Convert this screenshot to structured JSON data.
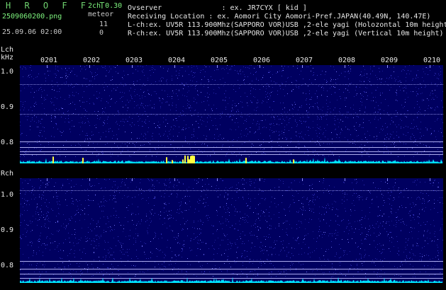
{
  "app_title": "H R O F F T",
  "file_name": "2509060200.png",
  "date_time": "25.09.06 02:00",
  "version": "2ch 0.30",
  "meteor_label": "meteor",
  "meteor_counts": {
    "lch": "11",
    "rch": "0"
  },
  "header": {
    "observer": "Ovserver              : ex. JR7CYX [ kid ]",
    "location": "Receiving Location : ex. Aomori City Aomori-Pref.JAPAN(40.49N, 140.47E)",
    "lch_info": "L-ch:ex. UV5R 113.900Mhz(SAPPORO VOR)USB ,2-ele yagi (Holozontal 10m height",
    "rch_info": "R-ch:ex. UV5R 113.900Mhz(SAPPORO VOR)USB ,2-ele yagi (Vertical 10m height)"
  },
  "channels": {
    "lch_label": "Lch",
    "unit": "kHz",
    "rch_label": "Rch"
  },
  "y_ticks": [
    "1.0",
    "0.9",
    "0.8"
  ],
  "time_ticks": [
    "0201",
    "0202",
    "0203",
    "0204",
    "0205",
    "0206",
    "0207",
    "0208",
    "0209",
    "0210"
  ],
  "colors": {
    "background": "#000000",
    "spectrogram": "#000060",
    "noise": "#3a3ad0",
    "carrier": "#b0b0ff",
    "level": "#00e5ff",
    "meteor": "#ffff40"
  }
}
